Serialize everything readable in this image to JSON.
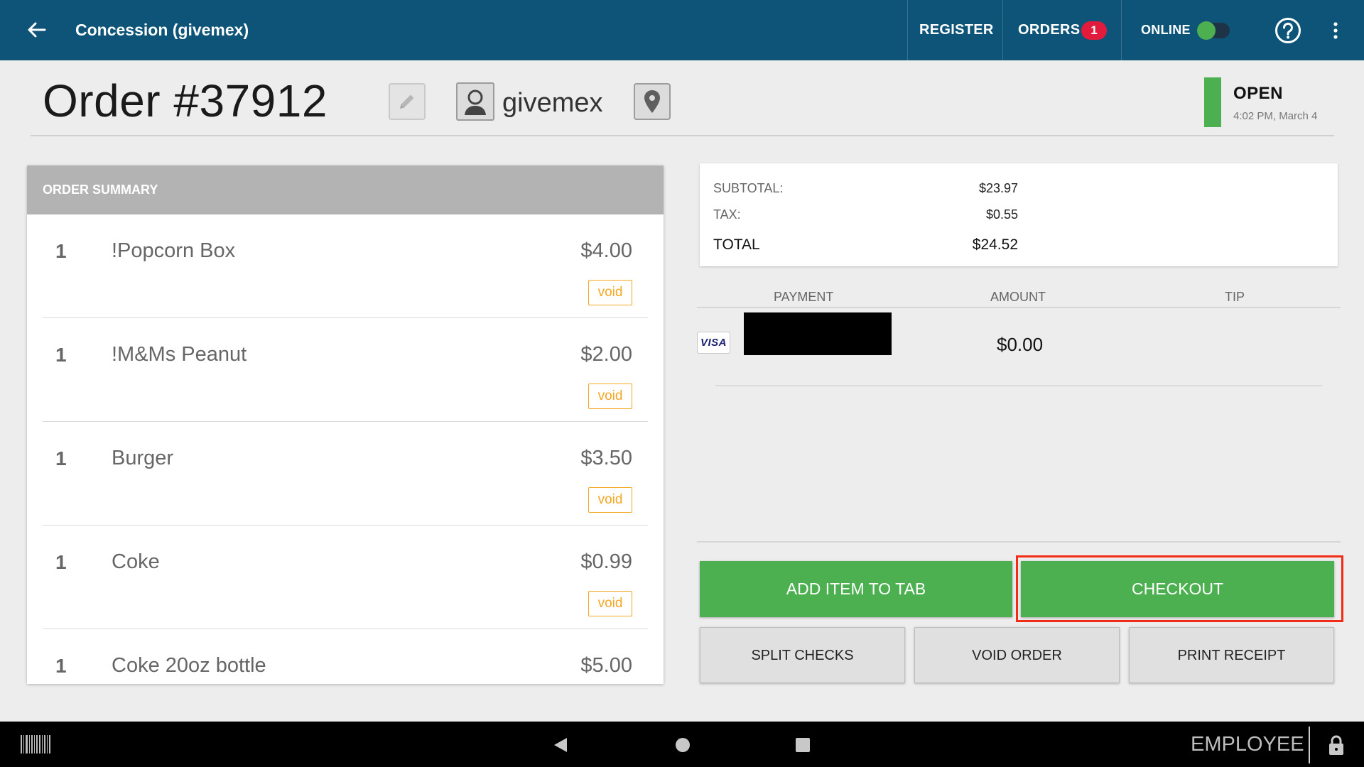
{
  "header": {
    "title": "Concession (givemex)",
    "register_label": "REGISTER",
    "orders_label": "ORDERS",
    "orders_badge": "1",
    "online_label": "ONLINE",
    "online_toggle": true
  },
  "order": {
    "title": "Order #37912",
    "customer_name": "givemex",
    "status": "OPEN",
    "status_time": "4:02 PM, March 4",
    "status_color": "#4caf50"
  },
  "summary": {
    "heading": "ORDER SUMMARY",
    "void_label": "void",
    "items": [
      {
        "qty": "1",
        "name": "!Popcorn Box",
        "price": "$4.00"
      },
      {
        "qty": "1",
        "name": "!M&Ms Peanut",
        "price": "$2.00"
      },
      {
        "qty": "1",
        "name": "Burger",
        "price": "$3.50"
      },
      {
        "qty": "1",
        "name": "Coke",
        "price": "$0.99"
      },
      {
        "qty": "1",
        "name": "Coke 20oz bottle",
        "price": "$5.00"
      }
    ]
  },
  "totals": {
    "subtotal_label": "SUBTOTAL:",
    "subtotal_value": "$23.97",
    "tax_label": "TAX:",
    "tax_value": "$0.55",
    "total_label": "TOTAL",
    "total_value": "$24.52"
  },
  "payments": {
    "col_payment": "PAYMENT",
    "col_amount": "AMOUNT",
    "col_tip": "TIP",
    "rows": [
      {
        "card_brand": "VISA",
        "amount": "$0.00"
      }
    ]
  },
  "actions": {
    "add_item": "ADD ITEM TO TAB",
    "checkout": "CHECKOUT",
    "split_checks": "SPLIT CHECKS",
    "void_order": "VOID ORDER",
    "print_receipt": "PRINT RECEIPT"
  },
  "system_bar": {
    "employee_label": "EMPLOYEE"
  },
  "colors": {
    "appbar": "#0d5478",
    "accent_green": "#4caf50",
    "badge_red": "#e21b3c",
    "void_orange": "#f5a623",
    "highlight_outline": "#f12c17"
  }
}
